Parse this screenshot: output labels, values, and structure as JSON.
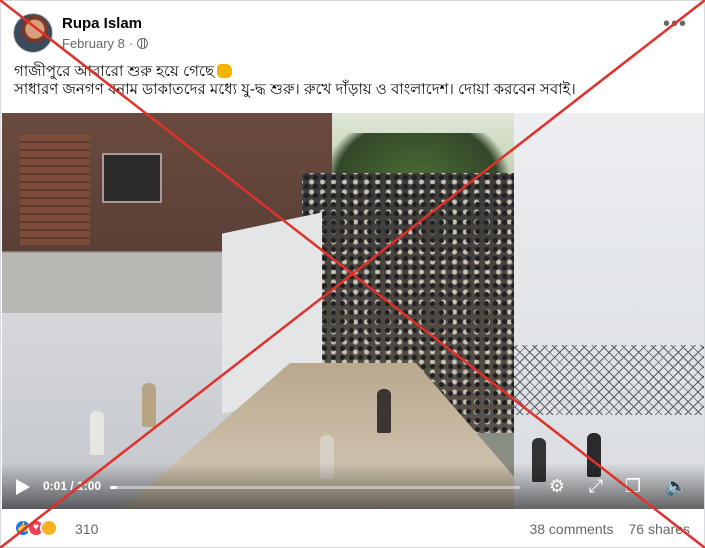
{
  "post": {
    "author": "Rupa Islam",
    "date": "February 8",
    "privacy_separator": "·",
    "more_icon": "more-dots-icon",
    "text_line1": "গাজীপুরে আবারো শুরু হয়ে গেছে",
    "text_line2": "সাধারণ জনগণ বনাম ডাকাতদের মধ্যে যু-দ্ধ শুরু। রুখে দাঁড়ায় ও বাংলাদেশ। দোয়া করবেন সবাই।"
  },
  "video": {
    "time": "0:01 / 1:00",
    "progress_fraction": 0.017,
    "icons": [
      "play-icon",
      "settings-icon",
      "fullscreen-icon",
      "pip-icon",
      "volume-icon"
    ]
  },
  "footer": {
    "reaction_count": "310",
    "comments": "38 comments",
    "shares": "76 shares"
  },
  "overlay": {
    "cross_color": "#e0312b"
  },
  "colors": {
    "secondary_text": "#65676b",
    "like": "#1877f2",
    "love": "#f33e58",
    "sad": "#f7b125"
  }
}
